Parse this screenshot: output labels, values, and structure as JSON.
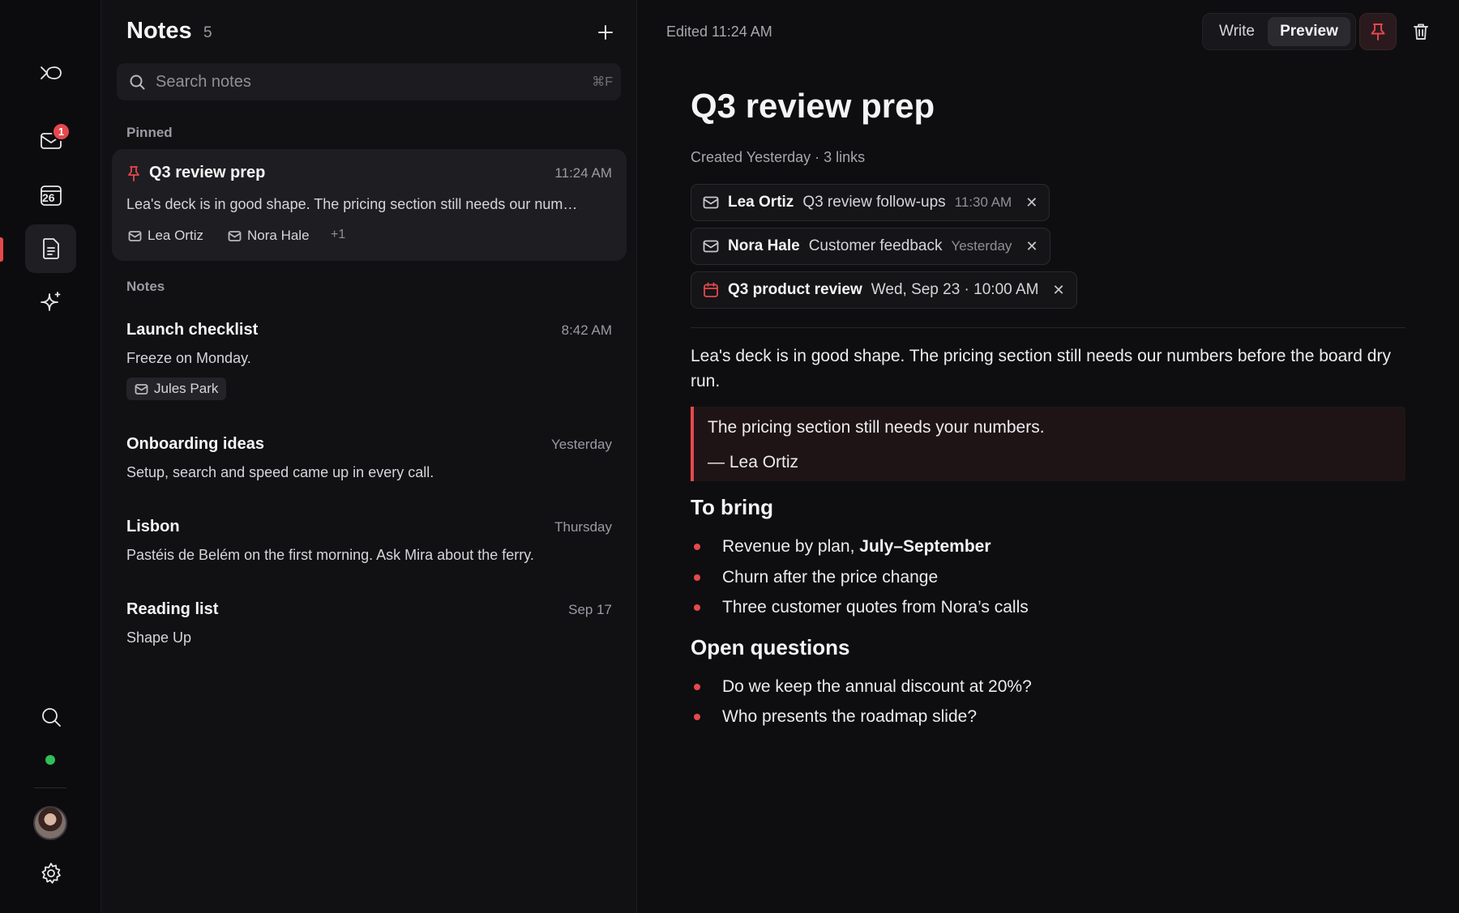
{
  "rail": {
    "inbox_badge": "1",
    "calendar_day": "26"
  },
  "list": {
    "title": "Notes",
    "count": "5",
    "search_placeholder": "Search notes",
    "search_shortcut": "⌘F",
    "section_pinned": "Pinned",
    "section_notes": "Notes",
    "pinned": [
      {
        "title": "Q3 review prep",
        "time": "11:24 AM",
        "preview": "Lea's deck is in good shape. The pricing section still needs our num…",
        "chips": [
          "Lea Ortiz",
          "Nora Hale"
        ],
        "more": "+1"
      }
    ],
    "notes": [
      {
        "title": "Launch checklist",
        "time": "8:42 AM",
        "preview": "Freeze on Monday.",
        "chip": "Jules Park"
      },
      {
        "title": "Onboarding ideas",
        "time": "Yesterday",
        "preview": "Setup, search and speed came up in every call."
      },
      {
        "title": "Lisbon",
        "time": "Thursday",
        "preview": "Pastéis de Belém on the first morning. Ask Mira about the ferry."
      },
      {
        "title": "Reading list",
        "time": "Sep 17",
        "preview": "Shape Up"
      }
    ]
  },
  "editor": {
    "edited": "Edited 11:24 AM",
    "mode_write": "Write",
    "mode_preview": "Preview",
    "title": "Q3 review prep",
    "meta": "Created Yesterday · 3 links",
    "links": [
      {
        "kind": "mail",
        "name": "Lea Ortiz",
        "subject": "Q3 review follow-ups",
        "time": "11:30 AM"
      },
      {
        "kind": "mail",
        "name": "Nora Hale",
        "subject": "Customer feedback",
        "time": "Yesterday"
      },
      {
        "kind": "event",
        "name": "Q3 product review",
        "subject": "Wed, Sep 23 · 10:00 AM",
        "time": ""
      }
    ],
    "paragraph": "Lea's deck is in good shape. The pricing section still needs our numbers before the board dry run.",
    "quote": "The pricing section still needs your numbers.",
    "quote_author": "— Lea Ortiz",
    "heading_bring": "To bring",
    "bring": [
      {
        "text": "Revenue by plan, ",
        "bold": "July–September"
      },
      {
        "text": "Churn after the price change",
        "bold": ""
      },
      {
        "text": "Three customer quotes from Nora’s calls",
        "bold": ""
      }
    ],
    "heading_questions": "Open questions",
    "questions": [
      "Do we keep the annual discount at 20%?",
      "Who presents the roadmap slide?"
    ]
  },
  "colors": {
    "accent": "#e5484d",
    "status_online": "#2fbf5a",
    "background": "#0e0e10"
  }
}
